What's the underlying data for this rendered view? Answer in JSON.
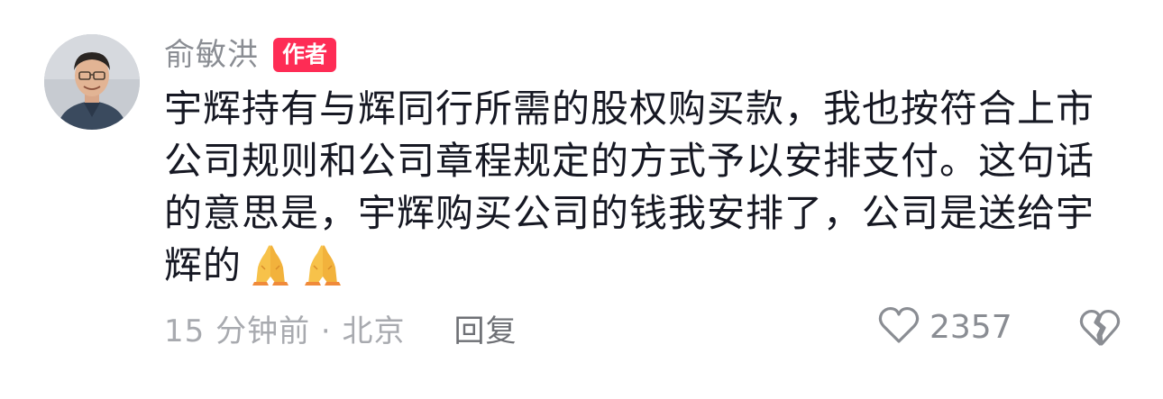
{
  "comment": {
    "author": {
      "name": "俞敏洪",
      "badge": "作者"
    },
    "text": "宇辉持有与辉同行所需的股权购买款，我也按符合上市公司规则和公司章程规定的方式予以安排支付。这句话的意思是，宇辉购买公司的钱我安排了，公司是送给宇辉的",
    "emojis": [
      "🙏",
      "🙏"
    ],
    "meta": "15 分钟前 · 北京",
    "reply_label": "回复",
    "like_count": "2357"
  },
  "colors": {
    "badge": "#fe2c55",
    "text": "#161823",
    "muted": "#a8aaaf"
  },
  "icons": {
    "like": "heart-outline-icon",
    "dislike": "broken-heart-icon",
    "emoji": "folded-hands-emoji"
  }
}
